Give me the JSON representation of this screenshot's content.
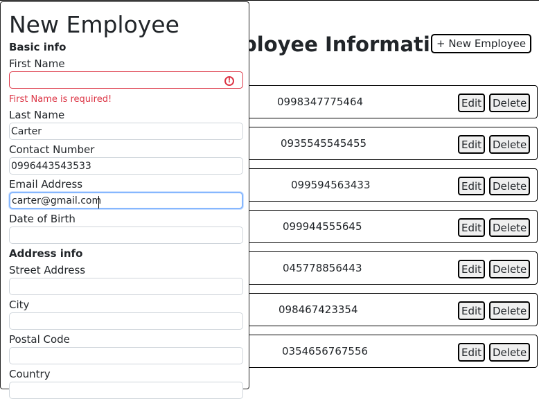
{
  "background": {
    "title": "Employee Information",
    "new_employee_button": "+ New Employee",
    "rows": [
      {
        "phone": "0998347775464",
        "edit": "Edit",
        "delete": "Delete"
      },
      {
        "phone": "0935545545455",
        "edit": "Edit",
        "delete": "Delete"
      },
      {
        "phone": "099594563433",
        "edit": "Edit",
        "delete": "Delete"
      },
      {
        "phone": "099944555645",
        "edit": "Edit",
        "delete": "Delete"
      },
      {
        "phone": "045778856443",
        "edit": "Edit",
        "delete": "Delete"
      },
      {
        "phone": "098467423354",
        "edit": "Edit",
        "delete": "Delete"
      },
      {
        "phone": "0354656767556",
        "edit": "Edit",
        "delete": "Delete"
      }
    ]
  },
  "form": {
    "title": "New Employee",
    "basic_info_label": "Basic info",
    "first_name": {
      "label": "First Name",
      "value": "",
      "error": "First Name is required!"
    },
    "last_name": {
      "label": "Last Name",
      "value": "Carter"
    },
    "contact_number": {
      "label": "Contact Number",
      "value": "0996443543533"
    },
    "email": {
      "label": "Email Address",
      "value": "carter@gmail.com"
    },
    "dob": {
      "label": "Date of Birth",
      "value": ""
    },
    "address_info_label": "Address info",
    "street": {
      "label": "Street Address",
      "value": ""
    },
    "city": {
      "label": "City",
      "value": ""
    },
    "postal_code": {
      "label": "Postal Code",
      "value": ""
    },
    "country": {
      "label": "Country",
      "value": ""
    }
  },
  "colors": {
    "error": "#dc3545",
    "focus_ring": "#86b7fe",
    "input_border": "#ced4da"
  },
  "icons": {
    "first_name_error": "exclamation-circle-icon"
  }
}
